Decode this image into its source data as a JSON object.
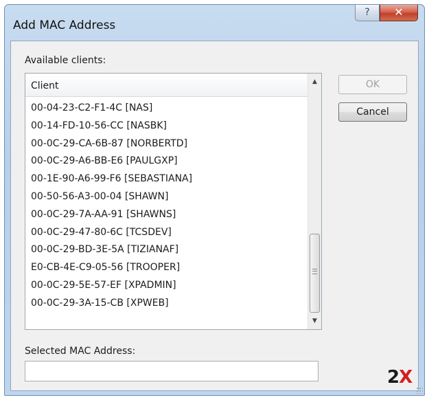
{
  "window": {
    "title": "Add MAC Address",
    "help_glyph": "?",
    "close_glyph": "✕"
  },
  "available_label": "Available clients:",
  "list": {
    "column_header": "Client",
    "items": [
      "00-04-23-C2-F1-4C [NAS]",
      "00-14-FD-10-56-CC [NASBK]",
      "00-0C-29-CA-6B-87 [NORBERTD]",
      "00-0C-29-A6-BB-E6 [PAULGXP]",
      "00-1E-90-A6-99-F6 [SEBASTIANA]",
      "00-50-56-A3-00-04 [SHAWN]",
      "00-0C-29-7A-AA-91 [SHAWNS]",
      "00-0C-29-47-80-6C [TCSDEV]",
      "00-0C-29-BD-3E-5A [TIZIANAF]",
      "E0-CB-4E-C9-05-56 [TROOPER]",
      "00-0C-29-5E-57-EF [XPADMIN]",
      "00-0C-29-3A-15-CB [XPWEB]"
    ]
  },
  "buttons": {
    "ok_label": "OK",
    "cancel_label": "Cancel"
  },
  "selected_mac": {
    "label": "Selected MAC Address:",
    "value": ""
  },
  "logo": {
    "text_main": "2",
    "text_x": "X"
  },
  "colors": {
    "close_button": "#c2412b",
    "logo_x": "#d21f1f"
  }
}
